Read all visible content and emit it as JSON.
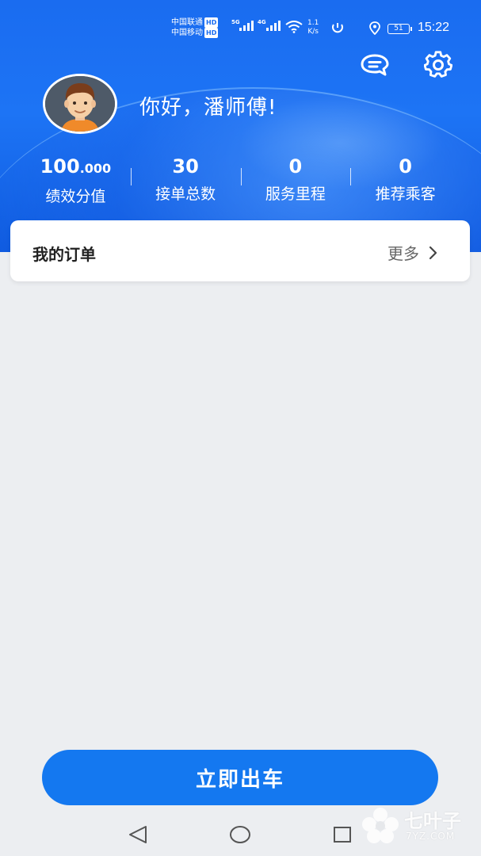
{
  "status_bar": {
    "carrier1": "中国联通",
    "carrier2": "中国移动",
    "hd": "HD",
    "net1": "5G",
    "net2": "4G",
    "speed_value": "1.1",
    "speed_unit": "K/s",
    "battery": "51",
    "time": "15:22"
  },
  "header": {
    "greeting": "你好，潘师傅!",
    "message_icon": "message-icon",
    "settings_icon": "gear-icon"
  },
  "stats": [
    {
      "value_int": "100",
      "value_dec": ".000",
      "label": "绩效分值"
    },
    {
      "value_int": "30",
      "value_dec": "",
      "label": "接单总数"
    },
    {
      "value_int": "0",
      "value_dec": "",
      "label": "服务里程"
    },
    {
      "value_int": "0",
      "value_dec": "",
      "label": "推荐乘客"
    }
  ],
  "orders": {
    "title": "我的订单",
    "more": "更多"
  },
  "actions": {
    "start_label": "立即出车"
  },
  "watermark": {
    "name": "七叶子",
    "domain": "7YZ.COM"
  },
  "colors": {
    "primary": "#1478f0",
    "header_bg": "#1a6cf0",
    "page_bg": "#eceef1"
  }
}
